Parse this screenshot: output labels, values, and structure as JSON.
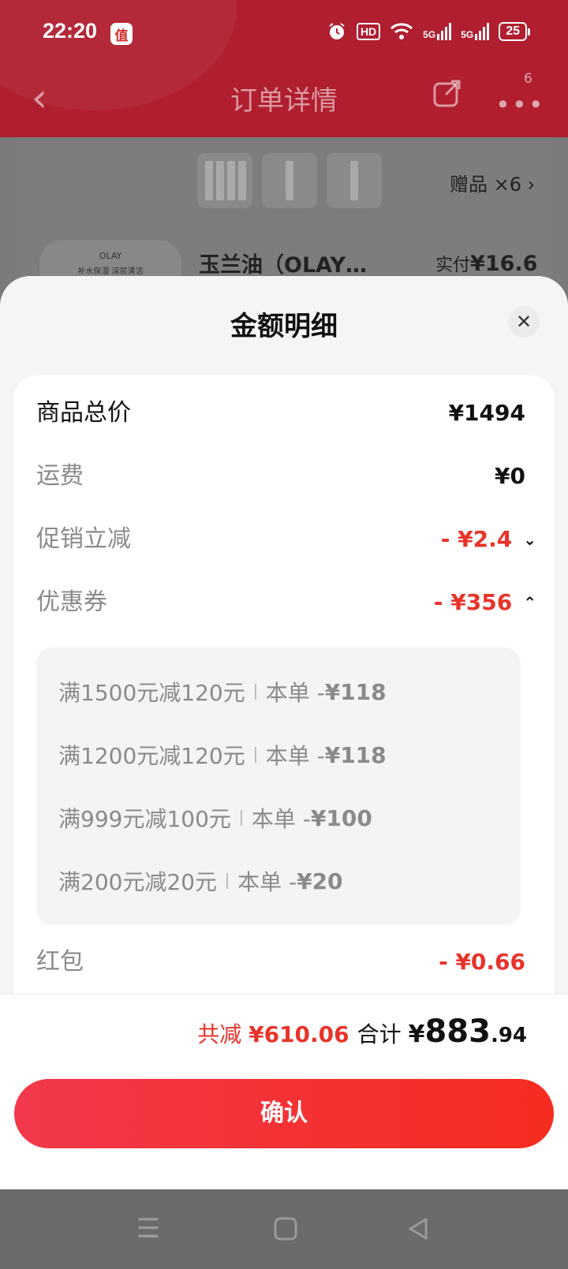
{
  "status_bar": {
    "time": "22:20",
    "app_badge": "值",
    "network_1": "5G",
    "network_2": "5G",
    "hd": "HD",
    "battery": "25",
    "icons": [
      "alarm-icon",
      "wifi-icon",
      "signal-icon"
    ]
  },
  "navbar": {
    "title": "订单详情",
    "more_count": "6"
  },
  "background_order": {
    "gift_label": "赠品 ×6",
    "product_name": "玉兰油（OLAY…",
    "paid_label": "实付",
    "paid_symbol": "¥",
    "paid_value": "16.6",
    "product_image_brand": "OLAY",
    "product_image_text": "补水保湿 深层清洁"
  },
  "sheet": {
    "title": "金额明细",
    "rows": [
      {
        "label": "商品总价",
        "value": "¥1494"
      },
      {
        "label": "运费",
        "value": "¥0"
      },
      {
        "label": "促销立减",
        "value": "- ¥2.4"
      },
      {
        "label": "优惠券",
        "value": "- ¥356"
      },
      {
        "label": "红包",
        "value": "- ¥0.66"
      }
    ],
    "coupons": [
      {
        "rule": "满1500元减120元",
        "prefix": "本单 -",
        "amount": "¥118"
      },
      {
        "rule": "满1200元减120元",
        "prefix": "本单 -",
        "amount": "¥118"
      },
      {
        "rule": "满999元减100元",
        "prefix": "本单 -",
        "amount": "¥100"
      },
      {
        "rule": "满200元减20元",
        "prefix": "本单 -",
        "amount": "¥20"
      }
    ]
  },
  "footer": {
    "discount_label": "共减",
    "discount_value": "¥610.06",
    "total_label": "合计",
    "total_symbol": "¥",
    "total_int": "883",
    "total_dec": ".94",
    "confirm_label": "确认"
  },
  "colors": {
    "header": "#b01e30",
    "accent_red": "#e8332a"
  }
}
